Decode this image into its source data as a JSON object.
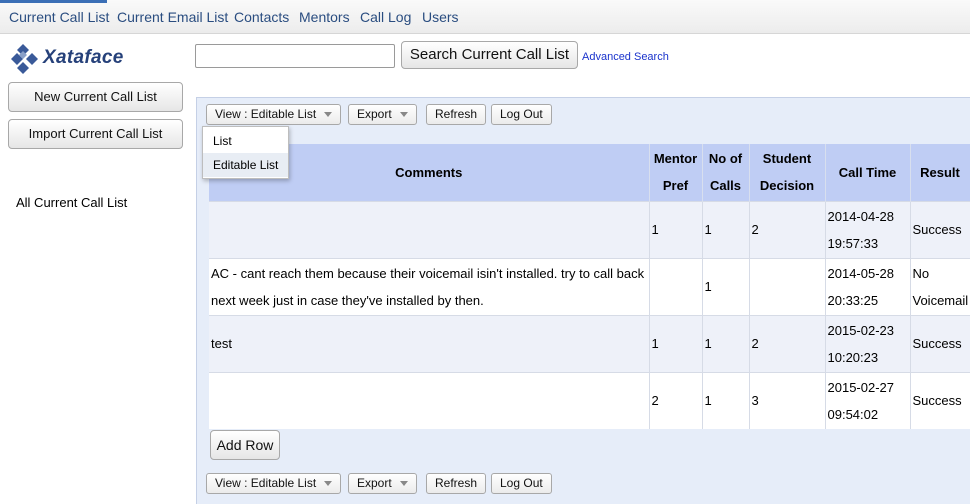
{
  "nav": {
    "tabs": [
      "Current Call List",
      "Current Email List",
      "Contacts",
      "Mentors",
      "Call Log",
      "Users"
    ]
  },
  "logo": {
    "text": "Xataface"
  },
  "search": {
    "value": "",
    "button_label": "Search Current Call List",
    "advanced_label": "Advanced Search"
  },
  "sidebar": {
    "new_button": "New Current Call List",
    "import_button": "Import Current Call List",
    "all_link": "All Current Call List"
  },
  "toolbar": {
    "view_label": "View : Editable List",
    "export_label": "Export",
    "refresh_label": "Refresh",
    "logout_label": "Log Out"
  },
  "view_menu": {
    "items": [
      "List",
      "Editable List"
    ],
    "selected": "Editable List"
  },
  "table": {
    "headers": {
      "comments": "Comments",
      "mentor_pref_1": "Mentor",
      "mentor_pref_2": "Pref",
      "no_calls_1": "No of",
      "no_calls_2": "Calls",
      "decision_1": "Student",
      "decision_2": "Decision",
      "call_time": "Call Time",
      "result": "Result"
    },
    "rows": [
      {
        "comments": "",
        "mentor_pref": "1",
        "no_calls": "1",
        "decision": "2",
        "call_date": "2014-04-28",
        "call_clock": "19:57:33",
        "result": "Success"
      },
      {
        "comments": "AC - cant reach them because their voicemail isin't installed. try to call back next week just in case they've installed by then.",
        "mentor_pref": "",
        "no_calls": "1",
        "decision": "",
        "call_date": "2014-05-28",
        "call_clock": "20:33:25",
        "result": "No Voicemail"
      },
      {
        "comments": "test",
        "mentor_pref": "1",
        "no_calls": "1",
        "decision": "2",
        "call_date": "2015-02-23",
        "call_clock": "10:20:23",
        "result": "Success"
      },
      {
        "comments": "",
        "mentor_pref": "2",
        "no_calls": "1",
        "decision": "3",
        "call_date": "2015-02-27",
        "call_clock": "09:54:02",
        "result": "Success"
      }
    ]
  },
  "add_row_label": "Add Row",
  "colors": {
    "header_bg": "#bfcdf4",
    "panel_bg": "#e6edf9",
    "link": "#2a4d80"
  }
}
